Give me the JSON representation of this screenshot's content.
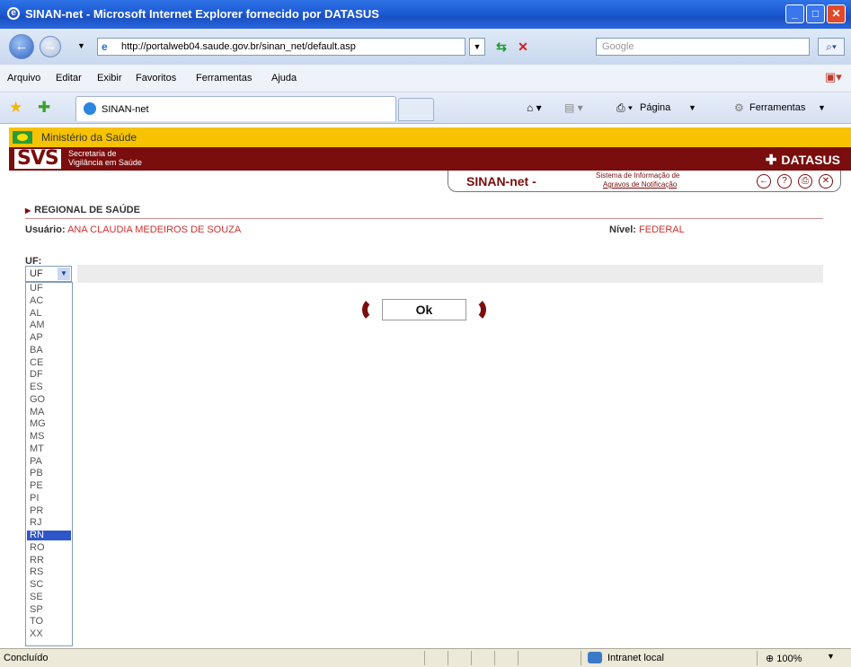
{
  "window": {
    "title": "SINAN-net - Microsoft Internet Explorer fornecido por DATASUS"
  },
  "nav": {
    "url": "http://portalweb04.saude.gov.br/sinan_net/default.asp",
    "search_placeholder": "Google"
  },
  "menu": [
    "Arquivo",
    "Editar",
    "Exibir",
    "Favoritos",
    "Ferramentas",
    "Ajuda"
  ],
  "tab": {
    "label": "SINAN-net"
  },
  "commands": {
    "page": "Página",
    "tools": "Ferramentas"
  },
  "header": {
    "ministerio": "Ministério da Saúde",
    "svs_logo": "SVS",
    "svs_line1": "Secretaria de",
    "svs_line2": "Vigilância em Saúde",
    "datasus": "DATASUS"
  },
  "sinan": {
    "title": "SINAN-net -",
    "subtitle_line1": "Sistema de Informação de",
    "subtitle_line2": "Agravos de Notificação"
  },
  "page": {
    "section_title": "REGIONAL DE SAÚDE",
    "user_label": "Usuário:",
    "user_value": "ANA CLAUDIA MEDEIROS DE SOUZA",
    "level_label": "Nível:",
    "level_value": "FEDERAL",
    "uf_label": "UF:",
    "uf_selected": "UF",
    "uf_options": [
      "UF",
      "AC",
      "AL",
      "AM",
      "AP",
      "BA",
      "CE",
      "DF",
      "ES",
      "GO",
      "MA",
      "MG",
      "MS",
      "MT",
      "PA",
      "PB",
      "PE",
      "PI",
      "PR",
      "RJ",
      "RN",
      "RO",
      "RR",
      "RS",
      "SC",
      "SE",
      "SP",
      "TO",
      "XX"
    ],
    "uf_highlighted": "RN",
    "ok_label": "Ok"
  },
  "status": {
    "text": "Concluído",
    "zone": "Intranet local",
    "zoom": "100%"
  },
  "colors": {
    "brand_dark_red": "#7a0d0d",
    "ministerio_yellow": "#f7c300",
    "highlight_blue": "#2f56c8",
    "value_red": "#d03030"
  }
}
